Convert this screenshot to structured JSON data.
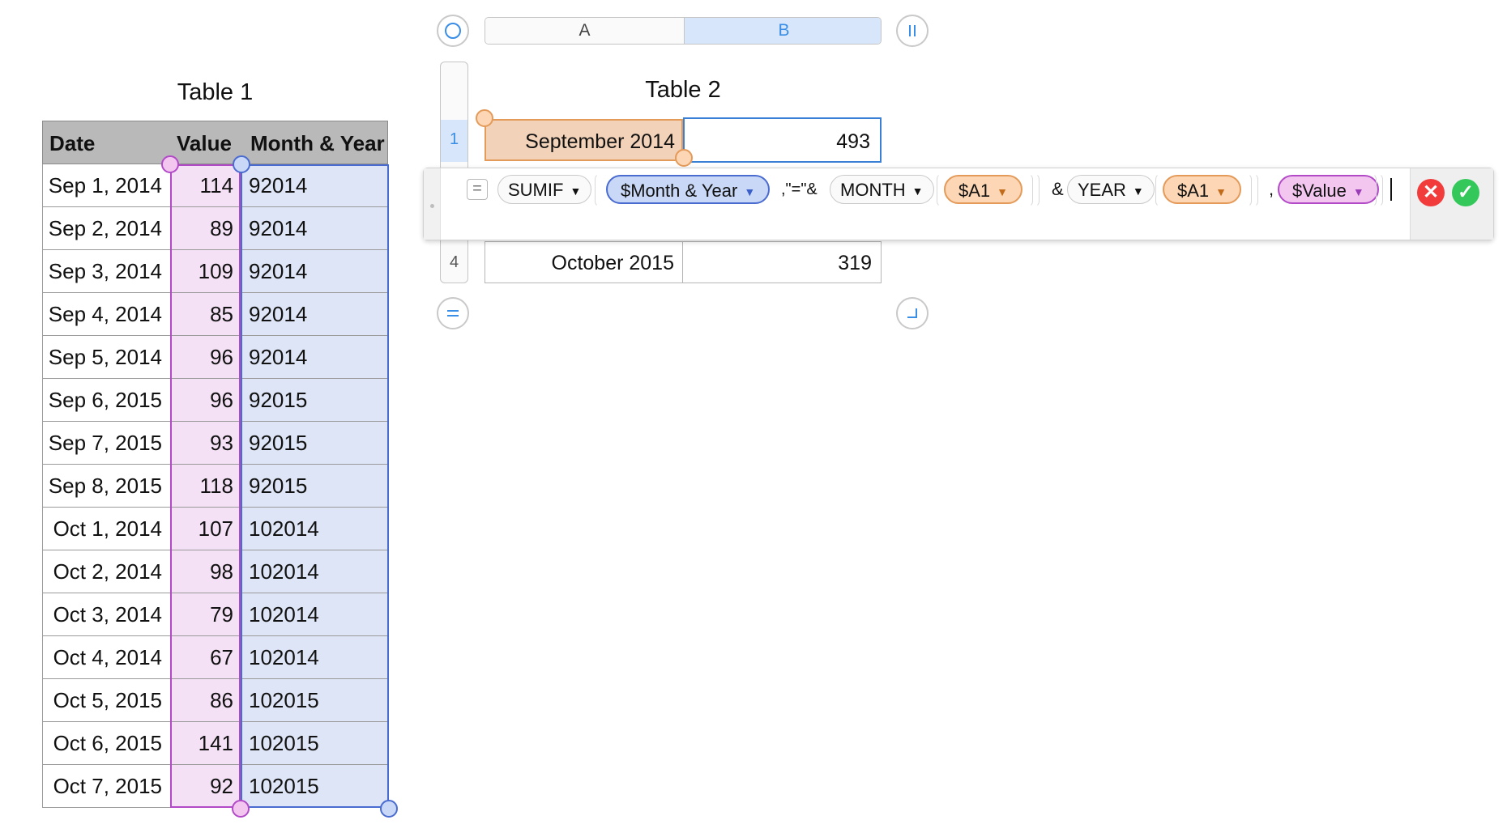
{
  "table1": {
    "title": "Table 1",
    "headers": [
      "Date",
      "Value",
      "Month & Year"
    ],
    "rows": [
      [
        "Sep 1, 2014",
        "114",
        "92014"
      ],
      [
        "Sep 2, 2014",
        "89",
        "92014"
      ],
      [
        "Sep 3, 2014",
        "109",
        "92014"
      ],
      [
        "Sep 4, 2014",
        "85",
        "92014"
      ],
      [
        "Sep 5, 2014",
        "96",
        "92014"
      ],
      [
        "Sep 6, 2015",
        "96",
        "92015"
      ],
      [
        "Sep 7, 2015",
        "93",
        "92015"
      ],
      [
        "Sep 8, 2015",
        "118",
        "92015"
      ],
      [
        "Oct 1, 2014",
        "107",
        "102014"
      ],
      [
        "Oct 2, 2014",
        "98",
        "102014"
      ],
      [
        "Oct 3, 2014",
        "79",
        "102014"
      ],
      [
        "Oct 4, 2014",
        "67",
        "102014"
      ],
      [
        "Oct 5, 2015",
        "86",
        "102015"
      ],
      [
        "Oct 6, 2015",
        "141",
        "102015"
      ],
      [
        "Oct 7, 2015",
        "92",
        "102015"
      ]
    ]
  },
  "table2": {
    "title": "Table 2",
    "column_headers": [
      "A",
      "B"
    ],
    "selected_column": "B",
    "row_numbers": [
      "1",
      "4"
    ],
    "row1": {
      "a": "September 2014",
      "b": "493"
    },
    "row4": {
      "a": "October 2015",
      "b": "319"
    }
  },
  "formula": {
    "equals": "=",
    "fn_sumif": "SUMIF",
    "ref_month_year": "$Month & Year",
    "str_eq": ",\"=\"&",
    "fn_month": "MONTH",
    "ref_a1_1": "$A1",
    "amp": "&",
    "fn_year": "YEAR",
    "ref_a1_2": "$A1",
    "comma": ",",
    "ref_value": "$Value",
    "cancel_symbol": "✕",
    "accept_symbol": "✓"
  },
  "colors": {
    "value_ref": "#b24ac8",
    "month_year_ref": "#4a6bd0",
    "cell_ref": "#e49a59",
    "cancel": "#f23b3b",
    "accept": "#34c85a"
  },
  "icons": [
    "table-select-icon",
    "add-column-icon",
    "add-row-icon",
    "resize-icon",
    "arrow-down-icon",
    "cancel-icon",
    "accept-icon"
  ]
}
